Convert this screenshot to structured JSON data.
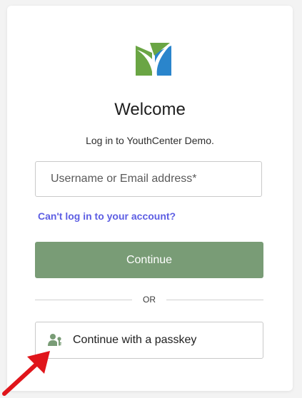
{
  "login": {
    "title": "Welcome",
    "subtitle": "Log in to YouthCenter Demo.",
    "username_placeholder": "Username or Email address*",
    "forgot_link": "Can't log in to your account?",
    "continue_label": "Continue",
    "divider_text": "OR",
    "passkey_label": "Continue with a passkey"
  },
  "icons": {
    "logo": "youthcenter-logo-icon",
    "passkey": "user-key-icon",
    "annotation": "red-arrow-icon"
  },
  "colors": {
    "primary_button": "#799c76",
    "link": "#5d5ee3",
    "logo_green": "#6aa544",
    "logo_blue": "#2a85cc",
    "arrow": "#e0151b"
  }
}
